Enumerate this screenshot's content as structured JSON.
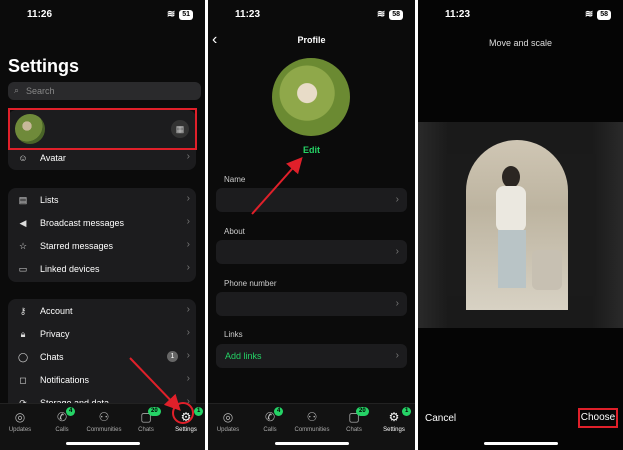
{
  "settings": {
    "time": "11:26",
    "battery": "51",
    "title": "Settings",
    "search_placeholder": "Search",
    "avatar_label": "Avatar",
    "group1": [
      "Lists",
      "Broadcast messages",
      "Starred messages",
      "Linked devices"
    ],
    "group2": [
      "Account",
      "Privacy",
      "Chats",
      "Notifications",
      "Storage and data"
    ],
    "chats_badge": "1"
  },
  "profile": {
    "time": "11:23",
    "battery": "58",
    "title": "Profile",
    "edit_label": "Edit",
    "name_label": "Name",
    "about_label": "About",
    "phone_label": "Phone number",
    "links_label": "Links",
    "add_links": "Add links"
  },
  "tabs": {
    "updates": "Updates",
    "calls": "Calls",
    "communities": "Communities",
    "chats": "Chats",
    "settings": "Settings",
    "calls_badge": "4",
    "chats_badge": "20",
    "settings_badge": "1"
  },
  "move_scale": {
    "time": "11:23",
    "battery": "58",
    "title": "Move and scale",
    "cancel": "Cancel",
    "choose": "Choose"
  },
  "colors": {
    "accent": "#25d366",
    "highlight": "#e0202a",
    "card": "#1c1c1e"
  },
  "icons": [
    "back-icon",
    "qr-code-icon",
    "list-icon",
    "megaphone-icon",
    "star-icon",
    "laptop-icon",
    "key-icon",
    "lock-icon",
    "chat-bubble-icon",
    "bell-icon",
    "storage-icon",
    "chevron-right-icon"
  ]
}
